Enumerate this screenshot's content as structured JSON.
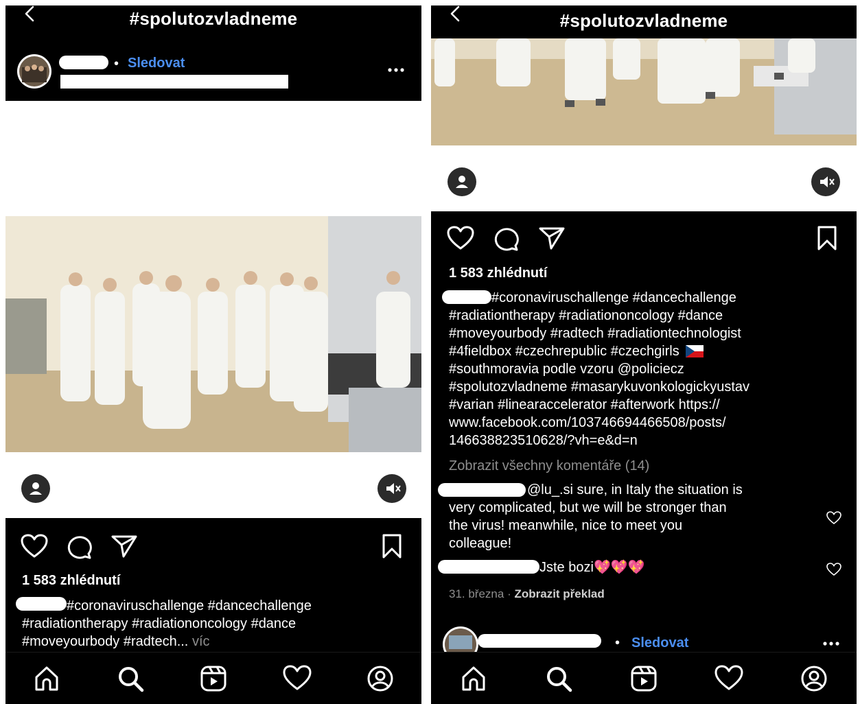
{
  "header": {
    "hashtag": "#spolutozvladneme"
  },
  "left": {
    "follow": "Sledovat",
    "views": "1 583 zhlédnutí",
    "caption_lines": [
      "#coronaviruschallenge #dancechallenge",
      "#radiationtherapy #radiationoncology #dance",
      "#moveyourbody #radtech..."
    ],
    "more": "víc"
  },
  "right": {
    "views": "1 583 zhlédnutí",
    "caption_lines": [
      "#coronaviruschallenge #dancechallenge",
      "#radiationtherapy #radiationoncology #dance",
      "#moveyourbody #radtech #radiationtechnologist",
      "#4fieldbox #czechrepublic #czechgirls",
      "#southmoravia podle vzoru @policiecz",
      "#spolutozvladneme #masarykuvonkologickyustav",
      "#varian #linearaccelerator #afterwork  https://",
      "www.facebook.com/103746694466508/posts/",
      "146638823510628/?vh=e&d=n"
    ],
    "view_all_comments": "Zobrazit všechny komentáře (14)",
    "comment1_lines": [
      "@lu_.si sure, in Italy the situation is",
      "very complicated, but we will be stronger than",
      "the virus!  meanwhile, nice to meet you",
      "colleague!"
    ],
    "comment2_text": "Jste bozi",
    "comment2_hearts": "💖💖💖",
    "date": "31. března",
    "translate": "Zobrazit překlad",
    "next_follow": "Sledovat"
  },
  "icons": {
    "nav": [
      "home-icon",
      "search-icon",
      "reels-icon",
      "activity-heart-icon",
      "profile-icon"
    ],
    "actions": [
      "like-heart-icon",
      "comment-icon",
      "share-icon",
      "save-bookmark-icon"
    ],
    "flag": "czech-flag-icon"
  },
  "colors": {
    "link": "#4b8ef0",
    "background": "#000000",
    "muted": "#8e8e8e"
  }
}
